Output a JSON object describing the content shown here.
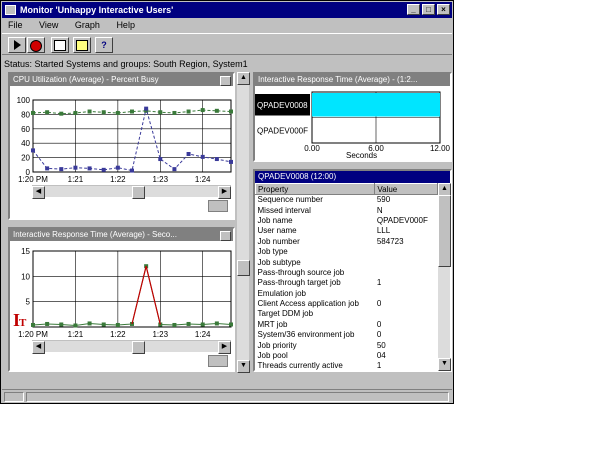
{
  "window": {
    "title": "Monitor 'Unhappy Interactive Users'"
  },
  "menu": [
    "File",
    "View",
    "Graph",
    "Help"
  ],
  "toolbar": {
    "icons": [
      "start-icon",
      "stop-icon",
      "properties-icon",
      "log-icon",
      "help-icon"
    ]
  },
  "status": {
    "line": "Status: Started     Systems and groups: South Region, System1"
  },
  "panes": {
    "cpu": {
      "title": "CPU Utilization (Average) - Percent Busy",
      "y_ticks": [
        "100",
        "80",
        "60",
        "40",
        "20",
        "0"
      ],
      "x_ticks": [
        "1:20 PM",
        "1:21",
        "1:22",
        "1:23",
        "1:24"
      ]
    },
    "irt_small": {
      "title": "Interactive Response Time (Average) - Seco...",
      "y_ticks": [
        "15",
        "10",
        "5"
      ],
      "x_ticks": [
        "1:20 PM",
        "1:21",
        "1:22",
        "1:23",
        "1:24"
      ]
    },
    "irt_bar": {
      "title": "Interactive Response Time (Average) - (1:2...",
      "categories": [
        "QPADEV0008",
        "QPADEV000F"
      ],
      "x_ticks": [
        "0.00",
        "6.00",
        "12.00"
      ],
      "xlabel": "Seconds"
    },
    "props": {
      "title": "QPADEV0008 (12:00)",
      "columns": [
        "Property",
        "Value"
      ],
      "rows": [
        [
          "Sequence number",
          "590"
        ],
        [
          "Missed interval",
          "N"
        ],
        [
          "Job name",
          "QPADEV000F"
        ],
        [
          "User name",
          "LLL"
        ],
        [
          "Job number",
          "584723"
        ],
        [
          "Job type",
          ""
        ],
        [
          "Job subtype",
          ""
        ],
        [
          "Pass-through source job",
          ""
        ],
        [
          "Pass-through target job",
          "1"
        ],
        [
          "Emulation job",
          ""
        ],
        [
          "Client Access application job",
          "0"
        ],
        [
          "Target DDM job",
          ""
        ],
        [
          "MRT job",
          "0"
        ],
        [
          "System/36 environment job",
          "0"
        ],
        [
          "Job priority",
          "50"
        ],
        [
          "Job pool",
          "04"
        ],
        [
          "Threads currently active",
          "1"
        ]
      ]
    }
  },
  "colors": {
    "title_active": "#000080",
    "bar_fill": "#00e5ff",
    "series_green": "#3a7a3a",
    "series_blue": "#3a3a9a",
    "peak_red": "#c00000"
  },
  "chart_data": [
    {
      "type": "line",
      "title": "CPU Utilization (Average) - Percent Busy",
      "x": [
        "1:20 PM",
        "",
        "",
        "1:21",
        "",
        "",
        "1:22",
        "",
        "",
        "1:23",
        "",
        "",
        "1:24",
        "",
        ""
      ],
      "series": [
        {
          "values": [
            82,
            83,
            81,
            82,
            84,
            83,
            82,
            84,
            85,
            83,
            82,
            84,
            86,
            85,
            84
          ]
        },
        {
          "values": [
            30,
            5,
            4,
            6,
            5,
            3,
            6,
            2,
            88,
            18,
            4,
            25,
            21,
            18,
            14
          ]
        }
      ],
      "ylim": [
        0,
        100
      ]
    },
    {
      "type": "line",
      "title": "Interactive Response Time (Average) - Seco...",
      "x": [
        "1:20 PM",
        "",
        "",
        "1:21",
        "",
        "",
        "1:22",
        "",
        "",
        "1:23",
        "",
        "",
        "1:24",
        "",
        ""
      ],
      "series": [
        {
          "values": [
            0.4,
            0.6,
            0.5,
            0.3,
            0.7,
            0.5,
            0.4,
            0.6,
            12.0,
            0.5,
            0.4,
            0.6,
            0.5,
            0.7,
            0.5
          ]
        }
      ],
      "ylim": [
        0,
        15
      ]
    },
    {
      "type": "bar",
      "title": "Interactive Response Time (Average) - (1:2...",
      "categories": [
        "QPADEV0008",
        "QPADEV000F"
      ],
      "values": [
        12.0,
        0.0
      ],
      "xlabel": "Seconds",
      "xlim": [
        0,
        12
      ]
    }
  ]
}
